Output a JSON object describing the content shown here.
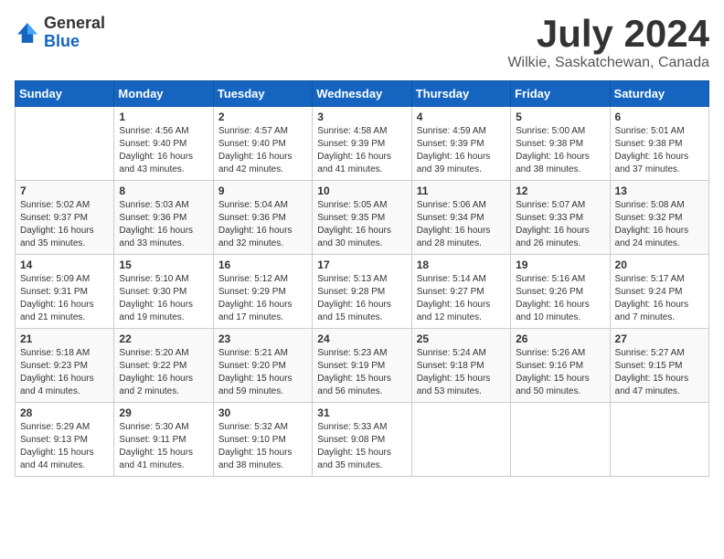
{
  "header": {
    "logo_general": "General",
    "logo_blue": "Blue",
    "month_title": "July 2024",
    "location": "Wilkie, Saskatchewan, Canada"
  },
  "weekdays": [
    "Sunday",
    "Monday",
    "Tuesday",
    "Wednesday",
    "Thursday",
    "Friday",
    "Saturday"
  ],
  "weeks": [
    [
      {
        "day": "",
        "sunrise": "",
        "sunset": "",
        "daylight": ""
      },
      {
        "day": "1",
        "sunrise": "Sunrise: 4:56 AM",
        "sunset": "Sunset: 9:40 PM",
        "daylight": "Daylight: 16 hours and 43 minutes."
      },
      {
        "day": "2",
        "sunrise": "Sunrise: 4:57 AM",
        "sunset": "Sunset: 9:40 PM",
        "daylight": "Daylight: 16 hours and 42 minutes."
      },
      {
        "day": "3",
        "sunrise": "Sunrise: 4:58 AM",
        "sunset": "Sunset: 9:39 PM",
        "daylight": "Daylight: 16 hours and 41 minutes."
      },
      {
        "day": "4",
        "sunrise": "Sunrise: 4:59 AM",
        "sunset": "Sunset: 9:39 PM",
        "daylight": "Daylight: 16 hours and 39 minutes."
      },
      {
        "day": "5",
        "sunrise": "Sunrise: 5:00 AM",
        "sunset": "Sunset: 9:38 PM",
        "daylight": "Daylight: 16 hours and 38 minutes."
      },
      {
        "day": "6",
        "sunrise": "Sunrise: 5:01 AM",
        "sunset": "Sunset: 9:38 PM",
        "daylight": "Daylight: 16 hours and 37 minutes."
      }
    ],
    [
      {
        "day": "7",
        "sunrise": "Sunrise: 5:02 AM",
        "sunset": "Sunset: 9:37 PM",
        "daylight": "Daylight: 16 hours and 35 minutes."
      },
      {
        "day": "8",
        "sunrise": "Sunrise: 5:03 AM",
        "sunset": "Sunset: 9:36 PM",
        "daylight": "Daylight: 16 hours and 33 minutes."
      },
      {
        "day": "9",
        "sunrise": "Sunrise: 5:04 AM",
        "sunset": "Sunset: 9:36 PM",
        "daylight": "Daylight: 16 hours and 32 minutes."
      },
      {
        "day": "10",
        "sunrise": "Sunrise: 5:05 AM",
        "sunset": "Sunset: 9:35 PM",
        "daylight": "Daylight: 16 hours and 30 minutes."
      },
      {
        "day": "11",
        "sunrise": "Sunrise: 5:06 AM",
        "sunset": "Sunset: 9:34 PM",
        "daylight": "Daylight: 16 hours and 28 minutes."
      },
      {
        "day": "12",
        "sunrise": "Sunrise: 5:07 AM",
        "sunset": "Sunset: 9:33 PM",
        "daylight": "Daylight: 16 hours and 26 minutes."
      },
      {
        "day": "13",
        "sunrise": "Sunrise: 5:08 AM",
        "sunset": "Sunset: 9:32 PM",
        "daylight": "Daylight: 16 hours and 24 minutes."
      }
    ],
    [
      {
        "day": "14",
        "sunrise": "Sunrise: 5:09 AM",
        "sunset": "Sunset: 9:31 PM",
        "daylight": "Daylight: 16 hours and 21 minutes."
      },
      {
        "day": "15",
        "sunrise": "Sunrise: 5:10 AM",
        "sunset": "Sunset: 9:30 PM",
        "daylight": "Daylight: 16 hours and 19 minutes."
      },
      {
        "day": "16",
        "sunrise": "Sunrise: 5:12 AM",
        "sunset": "Sunset: 9:29 PM",
        "daylight": "Daylight: 16 hours and 17 minutes."
      },
      {
        "day": "17",
        "sunrise": "Sunrise: 5:13 AM",
        "sunset": "Sunset: 9:28 PM",
        "daylight": "Daylight: 16 hours and 15 minutes."
      },
      {
        "day": "18",
        "sunrise": "Sunrise: 5:14 AM",
        "sunset": "Sunset: 9:27 PM",
        "daylight": "Daylight: 16 hours and 12 minutes."
      },
      {
        "day": "19",
        "sunrise": "Sunrise: 5:16 AM",
        "sunset": "Sunset: 9:26 PM",
        "daylight": "Daylight: 16 hours and 10 minutes."
      },
      {
        "day": "20",
        "sunrise": "Sunrise: 5:17 AM",
        "sunset": "Sunset: 9:24 PM",
        "daylight": "Daylight: 16 hours and 7 minutes."
      }
    ],
    [
      {
        "day": "21",
        "sunrise": "Sunrise: 5:18 AM",
        "sunset": "Sunset: 9:23 PM",
        "daylight": "Daylight: 16 hours and 4 minutes."
      },
      {
        "day": "22",
        "sunrise": "Sunrise: 5:20 AM",
        "sunset": "Sunset: 9:22 PM",
        "daylight": "Daylight: 16 hours and 2 minutes."
      },
      {
        "day": "23",
        "sunrise": "Sunrise: 5:21 AM",
        "sunset": "Sunset: 9:20 PM",
        "daylight": "Daylight: 15 hours and 59 minutes."
      },
      {
        "day": "24",
        "sunrise": "Sunrise: 5:23 AM",
        "sunset": "Sunset: 9:19 PM",
        "daylight": "Daylight: 15 hours and 56 minutes."
      },
      {
        "day": "25",
        "sunrise": "Sunrise: 5:24 AM",
        "sunset": "Sunset: 9:18 PM",
        "daylight": "Daylight: 15 hours and 53 minutes."
      },
      {
        "day": "26",
        "sunrise": "Sunrise: 5:26 AM",
        "sunset": "Sunset: 9:16 PM",
        "daylight": "Daylight: 15 hours and 50 minutes."
      },
      {
        "day": "27",
        "sunrise": "Sunrise: 5:27 AM",
        "sunset": "Sunset: 9:15 PM",
        "daylight": "Daylight: 15 hours and 47 minutes."
      }
    ],
    [
      {
        "day": "28",
        "sunrise": "Sunrise: 5:29 AM",
        "sunset": "Sunset: 9:13 PM",
        "daylight": "Daylight: 15 hours and 44 minutes."
      },
      {
        "day": "29",
        "sunrise": "Sunrise: 5:30 AM",
        "sunset": "Sunset: 9:11 PM",
        "daylight": "Daylight: 15 hours and 41 minutes."
      },
      {
        "day": "30",
        "sunrise": "Sunrise: 5:32 AM",
        "sunset": "Sunset: 9:10 PM",
        "daylight": "Daylight: 15 hours and 38 minutes."
      },
      {
        "day": "31",
        "sunrise": "Sunrise: 5:33 AM",
        "sunset": "Sunset: 9:08 PM",
        "daylight": "Daylight: 15 hours and 35 minutes."
      },
      {
        "day": "",
        "sunrise": "",
        "sunset": "",
        "daylight": ""
      },
      {
        "day": "",
        "sunrise": "",
        "sunset": "",
        "daylight": ""
      },
      {
        "day": "",
        "sunrise": "",
        "sunset": "",
        "daylight": ""
      }
    ]
  ]
}
